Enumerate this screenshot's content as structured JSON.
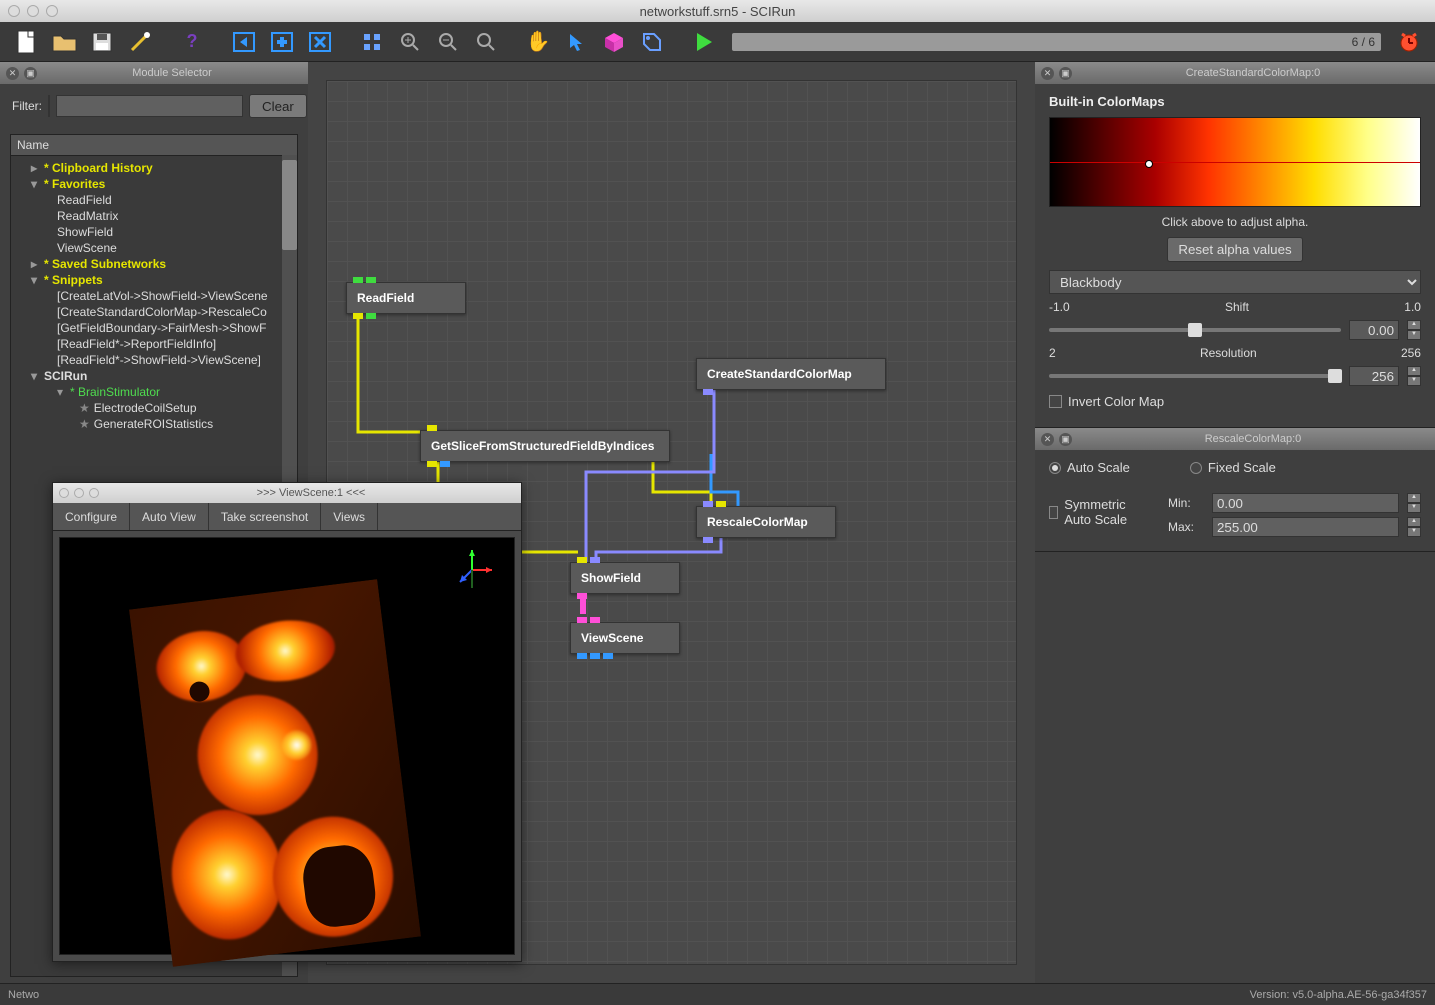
{
  "window": {
    "title": "networkstuff.srn5 - SCIRun"
  },
  "toolbar": {
    "progress_text": "6 / 6"
  },
  "module_selector": {
    "title": "Module Selector",
    "filter_label": "Filter:",
    "clear_label": "Clear",
    "name_header": "Name",
    "items": {
      "clipboard": "* Clipboard History",
      "favorites": "* Favorites",
      "fav_readfield": "ReadField",
      "fav_readmatrix": "ReadMatrix",
      "fav_showfield": "ShowField",
      "fav_viewscene": "ViewScene",
      "saved_subnets": "* Saved Subnetworks",
      "snippets": "* Snippets",
      "snip1": "[CreateLatVol->ShowField->ViewScene",
      "snip2": "[CreateStandardColorMap->RescaleCo",
      "snip3": "[GetFieldBoundary->FairMesh->ShowF",
      "snip4": "[ReadField*->ReportFieldInfo]",
      "snip5": "[ReadField*->ShowField->ViewScene]",
      "scirun": "SCIRun",
      "brainstim": "* BrainStimulator",
      "electrode": "ElectrodeCoilSetup",
      "genroi": "GenerateROIStatistics"
    }
  },
  "nodes": {
    "readfield": "ReadField",
    "createcm": "CreateStandardColorMap",
    "getslice": "GetSliceFromStructuredFieldByIndices",
    "rescale": "RescaleColorMap",
    "showfield": "ShowField",
    "viewscene": "ViewScene"
  },
  "colormap_panel": {
    "title": "CreateStandardColorMap:0",
    "builtin_label": "Built-in ColorMaps",
    "hint": "Click above to adjust alpha.",
    "reset_btn": "Reset alpha values",
    "selected": "Blackbody",
    "shift_label": "Shift",
    "shift_min": "-1.0",
    "shift_max": "1.0",
    "shift_val": "0.00",
    "res_label": "Resolution",
    "res_min": "2",
    "res_max": "256",
    "res_val": "256",
    "invert_label": "Invert Color Map"
  },
  "rescale_panel": {
    "title": "RescaleColorMap:0",
    "auto_label": "Auto Scale",
    "fixed_label": "Fixed Scale",
    "sym_label": "Symmetric Auto Scale",
    "min_label": "Min:",
    "max_label": "Max:",
    "min_val": "0.00",
    "max_val": "255.00"
  },
  "viewscene": {
    "title": ">>> ViewScene:1 <<<",
    "configure": "Configure",
    "autoview": "Auto View",
    "takeshot": "Take screenshot",
    "views": "Views"
  },
  "status": {
    "left": "Netwo",
    "version": "Version: v5.0-alpha.AE-56-ga34f357"
  }
}
